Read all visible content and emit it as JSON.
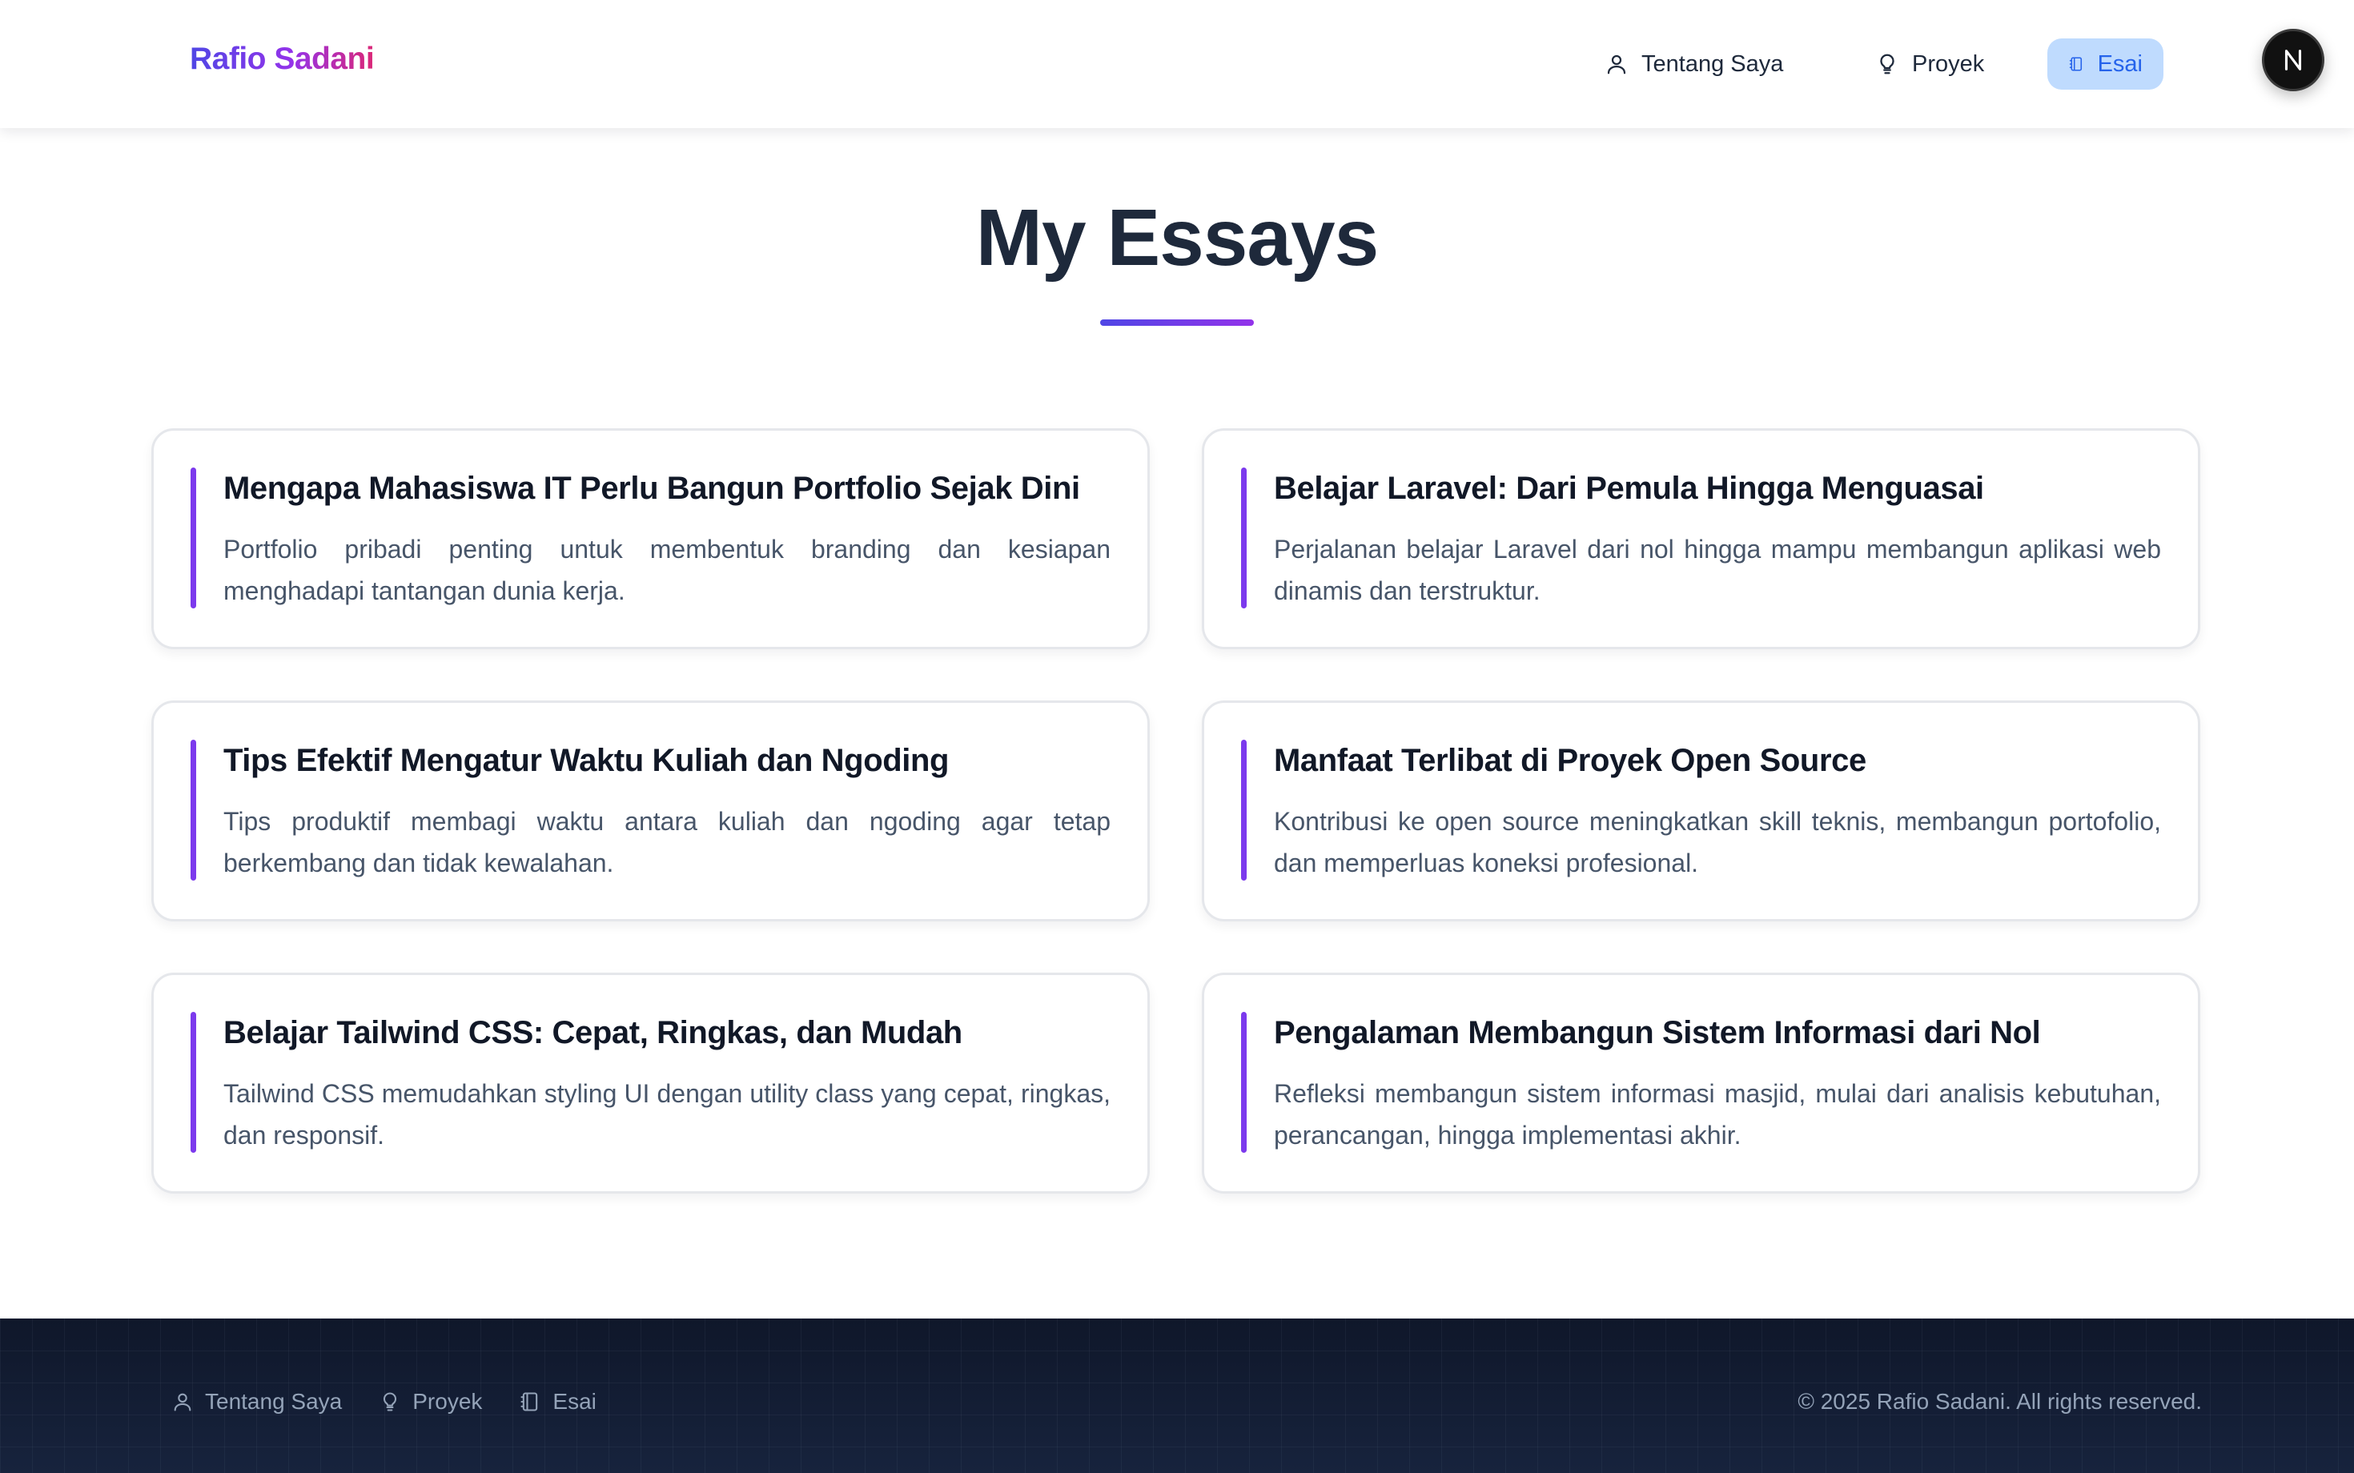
{
  "header": {
    "brand": "Rafio Sadani",
    "nav": [
      {
        "label": "Tentang Saya",
        "icon": "user-icon"
      },
      {
        "label": "Proyek",
        "icon": "lightbulb-icon"
      },
      {
        "label": "Esai",
        "icon": "notebook-icon",
        "active": true
      }
    ],
    "avatar_letter": "N"
  },
  "main": {
    "title": "My Essays",
    "essays": [
      {
        "title": "Mengapa Mahasiswa IT Perlu Bangun Portfolio Sejak Dini",
        "description": "Portfolio pribadi penting untuk membentuk branding dan kesiapan menghadapi tantangan dunia kerja."
      },
      {
        "title": "Belajar Laravel: Dari Pemula Hingga Menguasai",
        "description": "Perjalanan belajar Laravel dari nol hingga mampu membangun aplikasi web dinamis dan terstruktur."
      },
      {
        "title": "Tips Efektif Mengatur Waktu Kuliah dan Ngoding",
        "description": "Tips produktif membagi waktu antara kuliah dan ngoding agar tetap berkembang dan tidak kewalahan."
      },
      {
        "title": "Manfaat Terlibat di Proyek Open Source",
        "description": "Kontribusi ke open source meningkatkan skill teknis, membangun portofolio, dan memperluas koneksi profesional."
      },
      {
        "title": "Belajar Tailwind CSS: Cepat, Ringkas, dan Mudah",
        "description": "Tailwind CSS memudahkan styling UI dengan utility class yang cepat, ringkas, dan responsif."
      },
      {
        "title": "Pengalaman Membangun Sistem Informasi dari Nol",
        "description": "Refleksi membangun sistem informasi masjid, mulai dari analisis kebutuhan, perancangan, hingga implementasi akhir."
      }
    ]
  },
  "footer": {
    "nav": [
      {
        "label": "Tentang Saya",
        "icon": "user-icon"
      },
      {
        "label": "Proyek",
        "icon": "lightbulb-icon"
      },
      {
        "label": "Esai",
        "icon": "notebook-icon"
      }
    ],
    "copyright": "© 2025 Rafio Sadani. All rights reserved."
  },
  "colors": {
    "accent": "#7c3aed",
    "active_nav_bg": "#bfdbfe",
    "active_nav_text": "#2563eb",
    "footer_bg": "#0f172a"
  }
}
